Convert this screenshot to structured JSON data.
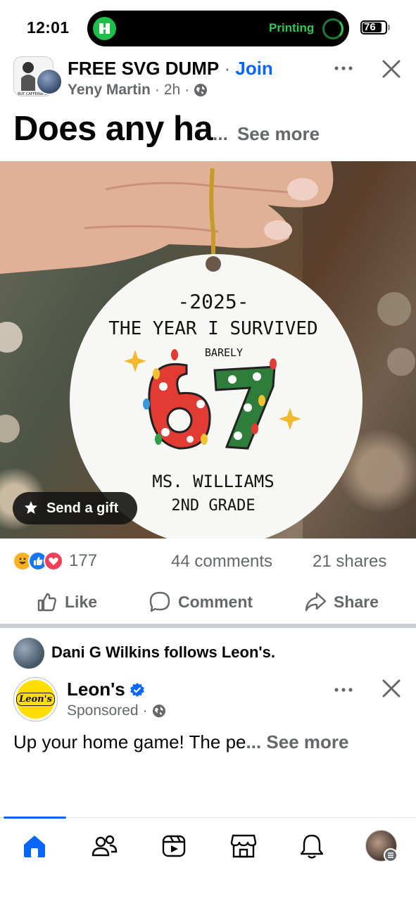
{
  "status_bar": {
    "time": "12:01",
    "island_activity": "Printing",
    "battery": "76"
  },
  "post": {
    "group_name": "FREE SVG DUMP",
    "separator": " · ",
    "join_label": "Join",
    "author": "Yeny Martin",
    "time_ago": "2h",
    "title_text": "Does any ha",
    "ellipsis": "...",
    "see_more": "See more",
    "image": {
      "ornament_year": "-2025-",
      "ornament_line1": "THE YEAR I SURVIVED",
      "ornament_barely": "BARELY",
      "ornament_number": "67",
      "ornament_name": "MS. WILLIAMS",
      "ornament_grade": "2ND GRADE"
    },
    "send_gift_label": "Send a gift",
    "reaction_count": "177",
    "comments": "44 comments",
    "shares": "21 shares",
    "actions": {
      "like": "Like",
      "comment": "Comment",
      "share": "Share"
    }
  },
  "next_post": {
    "follow_text": "Dani G Wilkins follows Leon's.",
    "page_name": "Leon's",
    "logo_text": "Leon's",
    "sponsored": "Sponsored",
    "ad_text": "Up your home game!  The pe",
    "ellipsis": "...",
    "see_more": "See more"
  },
  "nav": {
    "items": [
      "home-icon",
      "friends-icon",
      "video-icon",
      "marketplace-icon",
      "notifications-icon",
      "profile-avatar"
    ]
  },
  "colors": {
    "accent": "#0866ff",
    "secondary_text": "#65676b",
    "island_green": "#2ec94c",
    "leons_yellow": "#ffde00"
  }
}
